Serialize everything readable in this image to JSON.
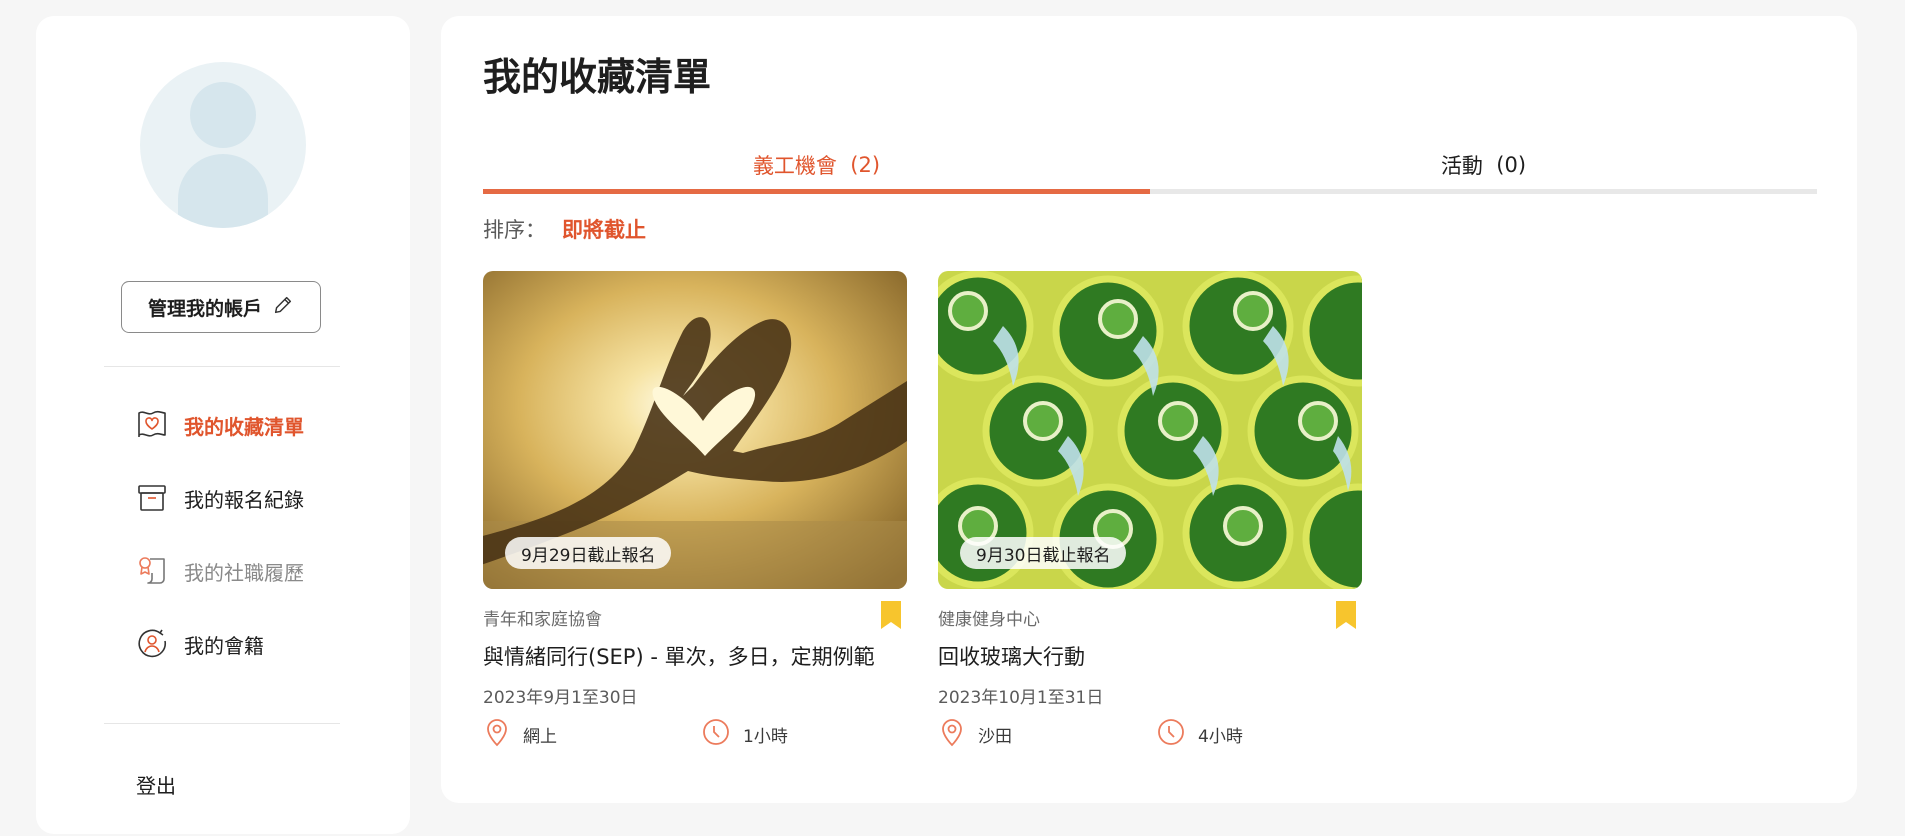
{
  "sidebar": {
    "manage_label": "管理我的帳戶",
    "nav": [
      {
        "label": "我的收藏清單"
      },
      {
        "label": "我的報名紀錄"
      },
      {
        "label": "我的社職履歷"
      },
      {
        "label": "我的會籍"
      }
    ],
    "logout": "登出"
  },
  "main": {
    "title": "我的收藏清單",
    "tabs": [
      {
        "label": "義工機會",
        "count": "(2)"
      },
      {
        "label": "活動",
        "count": "(0)"
      }
    ],
    "sort": {
      "label": "排序：",
      "value": "即將截止"
    },
    "cards": [
      {
        "deadline": "9月29日截止報名",
        "org": "青年和家庭協會",
        "title": "與情緒同行(SEP) - 單次，多日，定期例範",
        "dates": "2023年9月1至30日",
        "location": "網上",
        "duration": "1小時"
      },
      {
        "deadline": "9月30日截止報名",
        "org": "健康健身中心",
        "title": "回收玻璃大行動",
        "dates": "2023年10月1至31日",
        "location": "沙田",
        "duration": "4小時"
      }
    ]
  },
  "colors": {
    "accent": "#e0552d",
    "bookmark": "#f7c52d",
    "icon_orange": "#ec7b5c"
  }
}
